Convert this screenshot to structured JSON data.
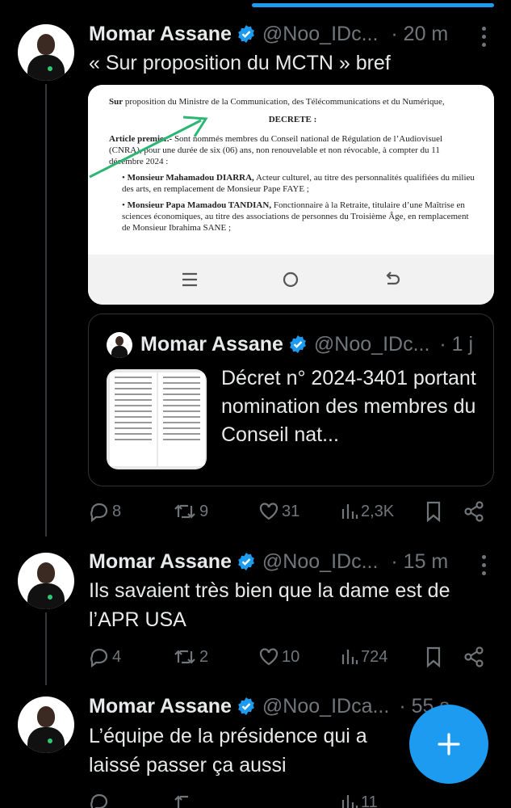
{
  "author": {
    "name": "Momar Assane",
    "handle_short": "@Noo_IDc...",
    "handle_alt": "@Noo_IDca..."
  },
  "tweets": [
    {
      "time": "· 20 m",
      "text": "« Sur proposition du MCTN » bref",
      "media": {
        "doc_line1_label": "Sur",
        "doc_line1": "proposition du Ministre de la Communication, des Télécommunications et du Numérique,",
        "doc_heading": "DECRETE :",
        "doc_article_label": "Article premier.-",
        "doc_article": "Sont nommés membres du Conseil national de Régulation de l’Audiovisuel (CNRA), pour une durée de six (06) ans, non renouvelable et non révocable, à compter du 11 décembre 2024 :",
        "doc_item1_label": "Monsieur Mahamadou DIARRA,",
        "doc_item1": "Acteur culturel, au titre des personnalités qualifiées du milieu des arts, en remplacement de Monsieur Pape FAYE ;",
        "doc_item2_label": "Monsieur Papa Mamadou TANDIAN,",
        "doc_item2": "Fonctionnaire à la Retraite, titulaire d’une Maîtrise en sciences économiques, au titre des associations de personnes du Troisième Âge, en remplacement de Monsieur Ibrahima SANE ;"
      },
      "quote": {
        "name": "Momar Assane",
        "handle": "@Noo_IDc...",
        "time": "· 1 j",
        "text": "Décret n° 2024-3401 portant nomination des membres du Conseil nat..."
      },
      "stats": {
        "replies": "8",
        "reposts": "9",
        "likes": "31",
        "views": "2,3K"
      }
    },
    {
      "time": "· 15 m",
      "text": "Ils savaient très bien que la dame est de l’APR USA",
      "stats": {
        "replies": "4",
        "reposts": "2",
        "likes": "10",
        "views": "724"
      }
    },
    {
      "time": "· 55 s",
      "text": "L’équipe de la présidence qui a laissé passer ça aussi",
      "stats": {
        "views": "11"
      }
    }
  ],
  "colors": {
    "accent": "#1d9bf0",
    "muted": "#71767b",
    "background": "#000000"
  },
  "icons": [
    "verified-badge-icon",
    "more-icon",
    "reply-icon",
    "repost-icon",
    "like-icon",
    "views-icon",
    "bookmark-icon",
    "share-icon",
    "compose-plus-icon",
    "menu-icon",
    "home-circle-icon",
    "back-icon"
  ]
}
